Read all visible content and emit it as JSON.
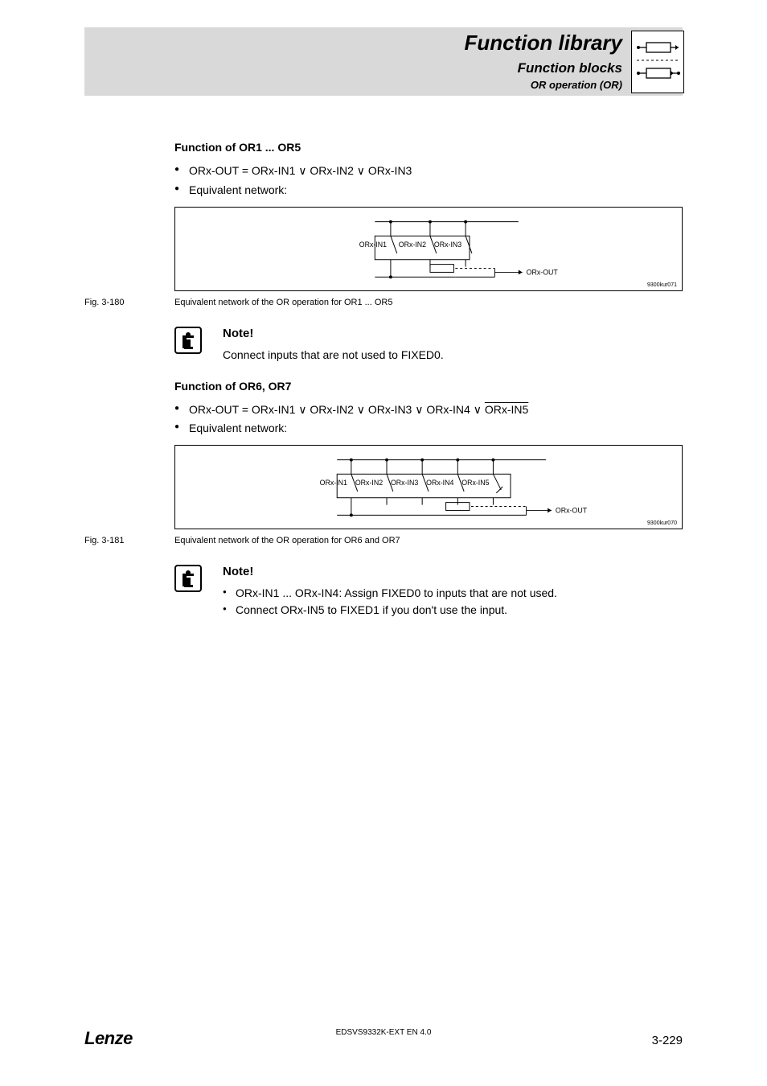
{
  "header": {
    "title": "Function library",
    "sub1": "Function blocks",
    "sub2": "OR operation (OR)"
  },
  "section1": {
    "heading": "Function of OR1 ... OR5",
    "bullet1_pre": "ORx-OUT = ORx-IN1 ",
    "bullet1_or1": "∨",
    "bullet1_mid1": " ORx-IN2 ",
    "bullet1_or2": "∨",
    "bullet1_mid2": " ORx-IN3",
    "bullet2": "Equivalent network:",
    "diagram_code": "9300kur071",
    "fig_label": "Fig. 3-180",
    "fig_caption": "Equivalent network of the OR operation for OR1 ... OR5"
  },
  "note1": {
    "title": "Note!",
    "text": "Connect inputs that are not used to FIXED0."
  },
  "section2": {
    "heading": "Function of OR6, OR7",
    "bullet1_pre": "ORx-OUT = ORx-IN1 ",
    "bullet1_or1": "∨",
    "bullet1_mid1": " ORx-IN2 ",
    "bullet1_or2": "∨",
    "bullet1_mid2": " ORx-IN3 ",
    "bullet1_or3": "∨",
    "bullet1_mid3": " ORx-IN4 ",
    "bullet1_or4": "∨",
    "bullet1_in5": "ORx-IN5",
    "bullet2": "Equivalent network:",
    "diagram_code": "9300kur070",
    "fig_label": "Fig. 3-181",
    "fig_caption": "Equivalent network of the OR operation for OR6 and OR7"
  },
  "note2": {
    "title": "Note!",
    "item1": "ORx-IN1 ... ORx-IN4: Assign FIXED0 to inputs that are not used.",
    "item2": "Connect ORx-IN5 to FIXED1 if you don't use the input."
  },
  "diagram_labels": {
    "in1": "ORx-IN1",
    "in2": "ORx-IN2",
    "in3": "ORx-IN3",
    "in4": "ORx-IN4",
    "in5": "ORx-IN5",
    "out": "ORx-OUT"
  },
  "footer": {
    "logo": "Lenze",
    "doc": "EDSVS9332K-EXT EN 4.0",
    "page": "3-229"
  }
}
